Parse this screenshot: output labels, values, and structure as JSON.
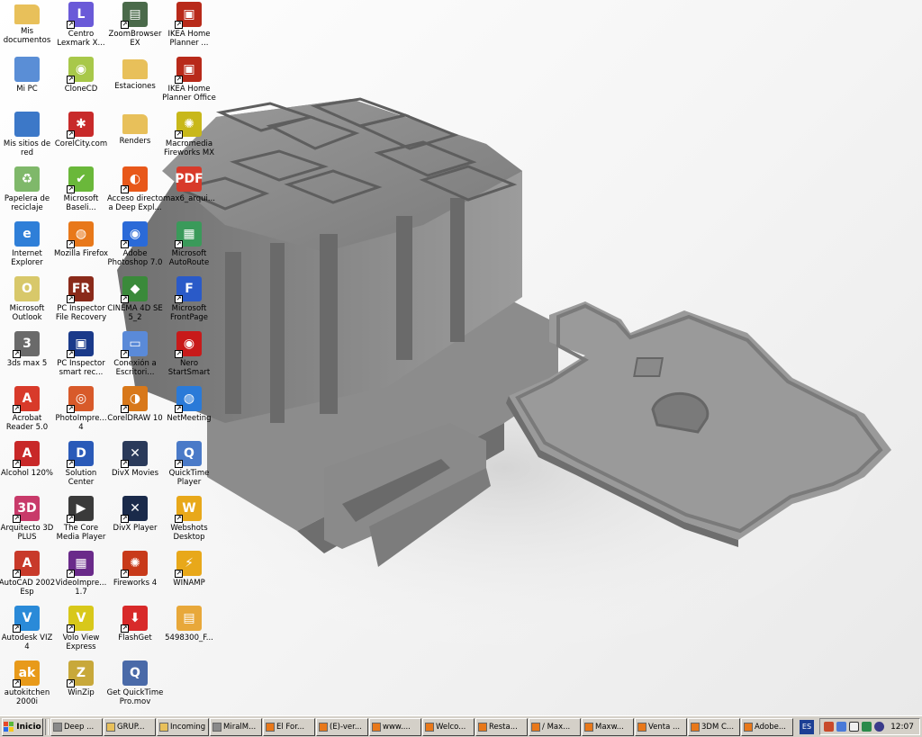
{
  "desktop": {
    "icons": [
      {
        "id": "mis-documentos",
        "label": "Mis documentos",
        "icon": "folder-documents-icon",
        "color": "#e8c05a",
        "glyph": "",
        "shortcut": false,
        "col": 0,
        "row": 0
      },
      {
        "id": "mi-pc",
        "label": "Mi PC",
        "icon": "computer-icon",
        "color": "#5a8ed6",
        "glyph": "",
        "shortcut": false,
        "col": 0,
        "row": 1
      },
      {
        "id": "mis-sitios-de-red",
        "label": "Mis sitios de red",
        "icon": "network-places-icon",
        "color": "#3c78c8",
        "glyph": "",
        "shortcut": false,
        "col": 0,
        "row": 2
      },
      {
        "id": "papelera",
        "label": "Papelera de reciclaje",
        "icon": "recycle-bin-icon",
        "color": "#7fb86a",
        "glyph": "♻",
        "shortcut": false,
        "col": 0,
        "row": 3
      },
      {
        "id": "internet-explorer",
        "label": "Internet Explorer",
        "icon": "internet-explorer-icon",
        "color": "#2f7fd8",
        "glyph": "e",
        "shortcut": false,
        "col": 0,
        "row": 4
      },
      {
        "id": "microsoft-outlook",
        "label": "Microsoft Outlook",
        "icon": "outlook-icon",
        "color": "#d8c86a",
        "glyph": "O",
        "shortcut": false,
        "col": 0,
        "row": 5
      },
      {
        "id": "3ds-max-5",
        "label": "3ds max 5",
        "icon": "3ds-max-icon",
        "color": "#6a6a6a",
        "glyph": "3",
        "shortcut": true,
        "col": 0,
        "row": 6
      },
      {
        "id": "acrobat-reader",
        "label": "Acrobat Reader 5.0",
        "icon": "acrobat-reader-icon",
        "color": "#d83a2a",
        "glyph": "A",
        "shortcut": true,
        "col": 0,
        "row": 7
      },
      {
        "id": "alcohol-120",
        "label": "Alcohol 120%",
        "icon": "alcohol-120-icon",
        "color": "#c82828",
        "glyph": "A",
        "shortcut": true,
        "col": 0,
        "row": 8
      },
      {
        "id": "arquitecto-3d",
        "label": "Arquitecto 3D PLUS",
        "icon": "arquitecto-3d-icon",
        "color": "#c83a6a",
        "glyph": "3D",
        "shortcut": true,
        "col": 0,
        "row": 9
      },
      {
        "id": "autocad-2002",
        "label": "AutoCAD 2002 Esp",
        "icon": "autocad-icon",
        "color": "#c83a2a",
        "glyph": "A",
        "shortcut": true,
        "col": 0,
        "row": 10
      },
      {
        "id": "autodesk-viz",
        "label": "Autodesk VIZ 4",
        "icon": "autodesk-viz-icon",
        "color": "#2a8ad8",
        "glyph": "V",
        "shortcut": true,
        "col": 0,
        "row": 11
      },
      {
        "id": "autokitchen",
        "label": "autokitchen 2000i",
        "icon": "autokitchen-icon",
        "color": "#e89a1a",
        "glyph": "ak",
        "shortcut": true,
        "col": 0,
        "row": 12
      },
      {
        "id": "centro-lexmark",
        "label": "Centro Lexmark X...",
        "icon": "lexmark-icon",
        "color": "#6a5ad8",
        "glyph": "L",
        "shortcut": true,
        "col": 1,
        "row": 0
      },
      {
        "id": "clonecd",
        "label": "CloneCD",
        "icon": "clonecd-icon",
        "color": "#a8c84a",
        "glyph": "◉",
        "shortcut": true,
        "col": 1,
        "row": 1
      },
      {
        "id": "corelcity",
        "label": "CorelCity.com",
        "icon": "corelcity-icon",
        "color": "#c82a2a",
        "glyph": "✱",
        "shortcut": true,
        "col": 1,
        "row": 2
      },
      {
        "id": "microsoft-baseline",
        "label": "Microsoft Baseli...",
        "icon": "baseline-analyzer-icon",
        "color": "#6ab83a",
        "glyph": "✔",
        "shortcut": true,
        "col": 1,
        "row": 3
      },
      {
        "id": "mozilla-firefox",
        "label": "Mozilla Firefox",
        "icon": "firefox-icon",
        "color": "#e8781a",
        "glyph": "◍",
        "shortcut": true,
        "col": 1,
        "row": 4
      },
      {
        "id": "pc-inspector-recovery",
        "label": "PC Inspector File Recovery",
        "icon": "pc-inspector-recovery-icon",
        "color": "#8a2a1a",
        "glyph": "FR",
        "shortcut": true,
        "col": 1,
        "row": 5
      },
      {
        "id": "pc-inspector-smart",
        "label": "PC Inspector smart rec...",
        "icon": "pc-inspector-smart-icon",
        "color": "#1a3a8a",
        "glyph": "▣",
        "shortcut": true,
        "col": 1,
        "row": 6
      },
      {
        "id": "photoimpression",
        "label": "PhotoImpre... 4",
        "icon": "photoimpression-icon",
        "color": "#d85a2a",
        "glyph": "◎",
        "shortcut": true,
        "col": 1,
        "row": 7
      },
      {
        "id": "solution-center",
        "label": "Solution Center",
        "icon": "dell-icon",
        "color": "#2a5ab8",
        "glyph": "D",
        "shortcut": true,
        "col": 1,
        "row": 8
      },
      {
        "id": "core-media-player",
        "label": "The Core Media Player",
        "icon": "core-media-player-icon",
        "color": "#3a3a3a",
        "glyph": "▶",
        "shortcut": true,
        "col": 1,
        "row": 9
      },
      {
        "id": "videoimpression",
        "label": "VideoImpre... 1.7",
        "icon": "videoimpression-icon",
        "color": "#6a2a8a",
        "glyph": "▦",
        "shortcut": true,
        "col": 1,
        "row": 10
      },
      {
        "id": "volo-view",
        "label": "Volo View Express",
        "icon": "volo-view-icon",
        "color": "#d8c81a",
        "glyph": "V",
        "shortcut": true,
        "col": 1,
        "row": 11
      },
      {
        "id": "winzip",
        "label": "WinZip",
        "icon": "winzip-icon",
        "color": "#c8a83a",
        "glyph": "Z",
        "shortcut": true,
        "col": 1,
        "row": 12
      },
      {
        "id": "zoombrowser",
        "label": "ZoomBrowser EX",
        "icon": "zoombrowser-icon",
        "color": "#4a6a4a",
        "glyph": "▤",
        "shortcut": true,
        "col": 2,
        "row": 0
      },
      {
        "id": "estaciones",
        "label": "Estaciones",
        "icon": "folder-icon",
        "color": "#e8c05a",
        "glyph": "",
        "shortcut": false,
        "col": 2,
        "row": 1
      },
      {
        "id": "renders",
        "label": "Renders",
        "icon": "folder-icon",
        "color": "#e8c05a",
        "glyph": "",
        "shortcut": false,
        "col": 2,
        "row": 2
      },
      {
        "id": "acceso-deep",
        "label": "Acceso directo a Deep Expl...",
        "icon": "deep-exploration-icon",
        "color": "#e8581a",
        "glyph": "◐",
        "shortcut": true,
        "col": 2,
        "row": 3
      },
      {
        "id": "photoshop",
        "label": "Adobe Photoshop 7.0",
        "icon": "photoshop-icon",
        "color": "#2a6ad8",
        "glyph": "◉",
        "shortcut": true,
        "col": 2,
        "row": 4
      },
      {
        "id": "cinema4d",
        "label": "CINEMA 4D SE 5_2",
        "icon": "cinema-4d-icon",
        "color": "#3a8a3a",
        "glyph": "◆",
        "shortcut": true,
        "col": 2,
        "row": 5
      },
      {
        "id": "conexion-escritorio",
        "label": "Conexión a Escritori...",
        "icon": "remote-desktop-icon",
        "color": "#5a8ad8",
        "glyph": "▭",
        "shortcut": true,
        "col": 2,
        "row": 6
      },
      {
        "id": "coreldraw",
        "label": "CorelDRAW 10",
        "icon": "coreldraw-icon",
        "color": "#d8781a",
        "glyph": "◑",
        "shortcut": true,
        "col": 2,
        "row": 7
      },
      {
        "id": "divx-movies",
        "label": "DivX Movies",
        "icon": "divx-movies-icon",
        "color": "#2a3a5a",
        "glyph": "✕",
        "shortcut": true,
        "col": 2,
        "row": 8
      },
      {
        "id": "divx-player",
        "label": "DivX Player",
        "icon": "divx-player-icon",
        "color": "#1a2a4a",
        "glyph": "✕",
        "shortcut": true,
        "col": 2,
        "row": 9
      },
      {
        "id": "fireworks-4",
        "label": "Fireworks 4",
        "icon": "fireworks-icon",
        "color": "#c83a1a",
        "glyph": "✺",
        "shortcut": true,
        "col": 2,
        "row": 10
      },
      {
        "id": "flashget",
        "label": "FlashGet",
        "icon": "flashget-icon",
        "color": "#d82a2a",
        "glyph": "⬇",
        "shortcut": true,
        "col": 2,
        "row": 11
      },
      {
        "id": "quicktime-get",
        "label": "Get QuickTime Pro.mov",
        "icon": "quicktime-movie-icon",
        "color": "#4a6aa8",
        "glyph": "Q",
        "shortcut": false,
        "col": 2,
        "row": 12
      },
      {
        "id": "ikea-home-planner",
        "label": "IKEA Home Planner ...",
        "icon": "ikea-home-planner-icon",
        "color": "#b82a1a",
        "glyph": "▣",
        "shortcut": true,
        "col": 3,
        "row": 0
      },
      {
        "id": "ikea-home-planner-office",
        "label": "IKEA Home Planner Office",
        "icon": "ikea-planner-office-icon",
        "color": "#b82a1a",
        "glyph": "▣",
        "shortcut": true,
        "col": 3,
        "row": 1
      },
      {
        "id": "fireworks-mx",
        "label": "Macromedia Fireworks MX",
        "icon": "fireworks-mx-icon",
        "color": "#c8b81a",
        "glyph": "✺",
        "shortcut": true,
        "col": 3,
        "row": 2
      },
      {
        "id": "max6-arqui",
        "label": "max6_arqui...",
        "icon": "pdf-file-icon",
        "color": "#d83a2a",
        "glyph": "PDF",
        "shortcut": false,
        "col": 3,
        "row": 3
      },
      {
        "id": "autoroute",
        "label": "Microsoft AutoRoute",
        "icon": "autoroute-icon",
        "color": "#3a9a5a",
        "glyph": "▦",
        "shortcut": true,
        "col": 3,
        "row": 4
      },
      {
        "id": "frontpage",
        "label": "Microsoft FrontPage",
        "icon": "frontpage-icon",
        "color": "#2a5ac8",
        "glyph": "F",
        "shortcut": true,
        "col": 3,
        "row": 5
      },
      {
        "id": "nero",
        "label": "Nero StartSmart",
        "icon": "nero-icon",
        "color": "#c81a1a",
        "glyph": "◉",
        "shortcut": true,
        "col": 3,
        "row": 6
      },
      {
        "id": "netmeeting",
        "label": "NetMeeting",
        "icon": "netmeeting-icon",
        "color": "#2a7ad8",
        "glyph": "◍",
        "shortcut": true,
        "col": 3,
        "row": 7
      },
      {
        "id": "quicktime-player",
        "label": "QuickTime Player",
        "icon": "quicktime-icon",
        "color": "#4a7ac8",
        "glyph": "Q",
        "shortcut": true,
        "col": 3,
        "row": 8
      },
      {
        "id": "webshots",
        "label": "Webshots Desktop",
        "icon": "webshots-icon",
        "color": "#e8a81a",
        "glyph": "W",
        "shortcut": true,
        "col": 3,
        "row": 9
      },
      {
        "id": "winamp",
        "label": "WINAMP",
        "icon": "winamp-icon",
        "color": "#e8a81a",
        "glyph": "⚡",
        "shortcut": true,
        "col": 3,
        "row": 10
      },
      {
        "id": "file-5498300",
        "label": "5498300_F...",
        "icon": "image-file-icon",
        "color": "#e8a83a",
        "glyph": "▤",
        "shortcut": false,
        "col": 3,
        "row": 11
      }
    ]
  },
  "taskbar": {
    "start_label": "Inicio",
    "tasks": [
      {
        "label": "Deep ...",
        "icon": "deep-exploration-icon"
      },
      {
        "label": "GRUP...",
        "icon": "folder-icon"
      },
      {
        "label": "Incoming",
        "icon": "folder-icon"
      },
      {
        "label": "MiralM...",
        "icon": "window-icon"
      },
      {
        "label": "El For...",
        "icon": "firefox-icon"
      },
      {
        "label": "(E)-ver...",
        "icon": "firefox-icon"
      },
      {
        "label": "www....",
        "icon": "firefox-icon"
      },
      {
        "label": "Welco...",
        "icon": "firefox-icon"
      },
      {
        "label": "Resta...",
        "icon": "firefox-icon"
      },
      {
        "label": "/ Max...",
        "icon": "firefox-icon"
      },
      {
        "label": "Maxw...",
        "icon": "firefox-icon"
      },
      {
        "label": "Venta ...",
        "icon": "firefox-icon"
      },
      {
        "label": "3DM C...",
        "icon": "firefox-icon"
      },
      {
        "label": "Adobe...",
        "icon": "firefox-icon"
      }
    ],
    "language": "ES",
    "clock": "12:07"
  },
  "colors": {
    "taskbar": "#d4d0c8",
    "wallpaper_model": "#8a8a8a"
  }
}
